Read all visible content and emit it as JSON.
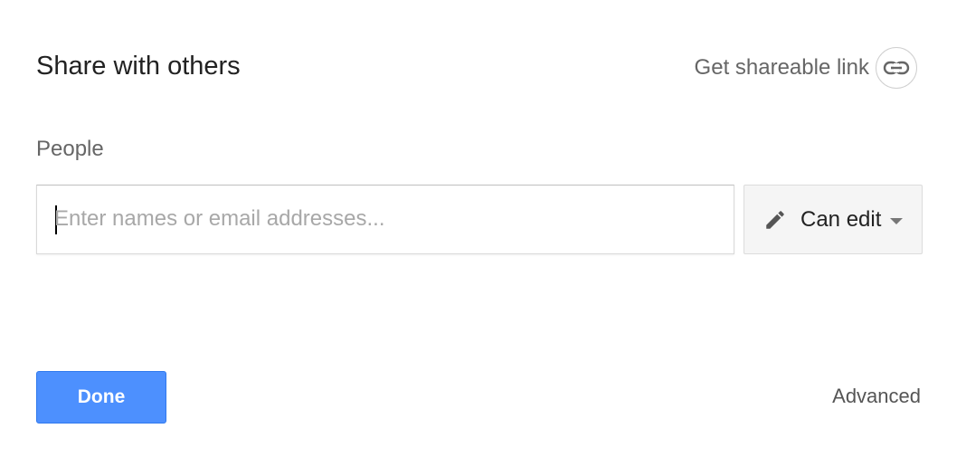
{
  "dialog": {
    "title": "Share with others",
    "share_link_label": "Get shareable link",
    "people_label": "People",
    "people_input": {
      "value": "",
      "placeholder": "Enter names or email addresses..."
    },
    "permission": {
      "selected": "Can edit",
      "icon": "pencil-icon"
    },
    "done_label": "Done",
    "advanced_label": "Advanced"
  },
  "colors": {
    "primary_button": "#4d90fe",
    "title_text": "#222222",
    "secondary_text": "#666666"
  },
  "icons": {
    "share_link": "link-icon",
    "permission": "pencil-icon",
    "dropdown": "chevron-down-icon"
  }
}
